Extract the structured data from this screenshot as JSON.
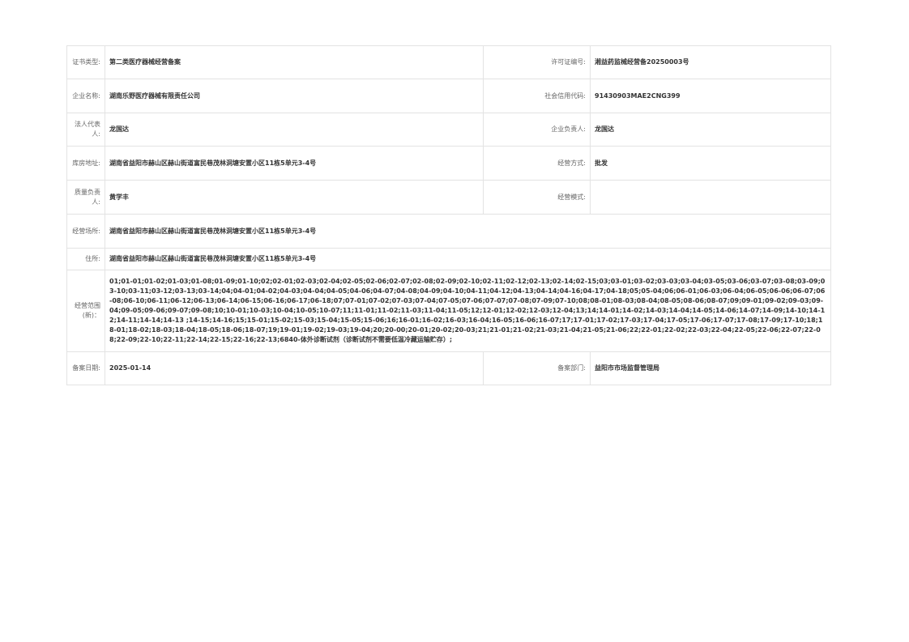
{
  "rows": [
    {
      "label1": "证书类型:",
      "value1": "第二类医疗器械经营备案",
      "label2": "许可证编号:",
      "value2": "湘益药监械经营备20250003号"
    },
    {
      "label1": "企业名称:",
      "value1": "湖南乐野医疗器械有限责任公司",
      "label2": "社会信用代码:",
      "value2": "91430903MAE2CNG399"
    },
    {
      "label1": "法人代表人:",
      "value1": "龙国达",
      "label2": "企业负责人:",
      "value2": "龙国达"
    },
    {
      "label1": "库房地址:",
      "value1": "湖南省益阳市赫山区赫山街道富民巷茂林洞塘安置小区11栋5单元3-4号",
      "label2": "经营方式:",
      "value2": "批发"
    },
    {
      "label1": "质量负责人:",
      "value1": "黄学丰",
      "label2": "经营模式:",
      "value2": ""
    }
  ],
  "business_site": {
    "label": "经营场所:",
    "value": "湖南省益阳市赫山区赫山街道富民巷茂林洞塘安置小区11栋5单元3-4号"
  },
  "residence": {
    "label": "住所:",
    "value": "湖南省益阳市赫山区赫山街道富民巷茂林洞塘安置小区11栋5单元3-4号"
  },
  "scope": {
    "label": "经营范围(新)：",
    "value": "01;01-01;01-02;01-03;01-08;01-09;01-10;02;02-01;02-03;02-04;02-05;02-06;02-07;02-08;02-09;02-10;02-11;02-12;02-13;02-14;02-15;03;03-01;03-02;03-03;03-04;03-05;03-06;03-07;03-08;03-09;03-10;03-11;03-12;03-13;03-14;04;04-01;04-02;04-03;04-04;04-05;04-06;04-07;04-08;04-09;04-10;04-11;04-12;04-13;04-14;04-16;04-17;04-18;05;05-04;06;06-01;06-03;06-04;06-05;06-06;06-07;06-08;06-10;06-11;06-12;06-13;06-14;06-15;06-16;06-17;06-18;07;07-01;07-02;07-03;07-04;07-05;07-06;07-07;07-08;07-09;07-10;08;08-01;08-03;08-04;08-05;08-06;08-07;09;09-01;09-02;09-03;09-04;09-05;09-06;09-07;09-08;10;10-01;10-03;10-04;10-05;10-07;11;11-01;11-02;11-03;11-04;11-05;12;12-01;12-02;12-03;12-04;13;14;14-01;14-02;14-03;14-04;14-05;14-06;14-07;14-09;14-10;14-12;14-11;14-14;14-13 ;14-15;14-16;15;15-01;15-02;15-03;15-04;15-05;15-06;16;16-01;16-02;16-03;16-04;16-05;16-06;16-07;17;17-01;17-02;17-03;17-04;17-05;17-06;17-07;17-08;17-09;17-10;18;18-01;18-02;18-03;18-04;18-05;18-06;18-07;19;19-01;19-02;19-03;19-04;20;20-00;20-01;20-02;20-03;21;21-01;21-02;21-03;21-04;21-05;21-06;22;22-01;22-02;22-03;22-04;22-05;22-06;22-07;22-08;22-09;22-10;22-11;22-14;22-15;22-16;22-13;6840-体外诊断试剂（诊断试剂不需要低温冷藏运输贮存）;"
  },
  "last_row": {
    "label1": "备案日期:",
    "value1": "2025-01-14",
    "label2": "备案部门:",
    "value2": "益阳市市场监督管理局"
  }
}
